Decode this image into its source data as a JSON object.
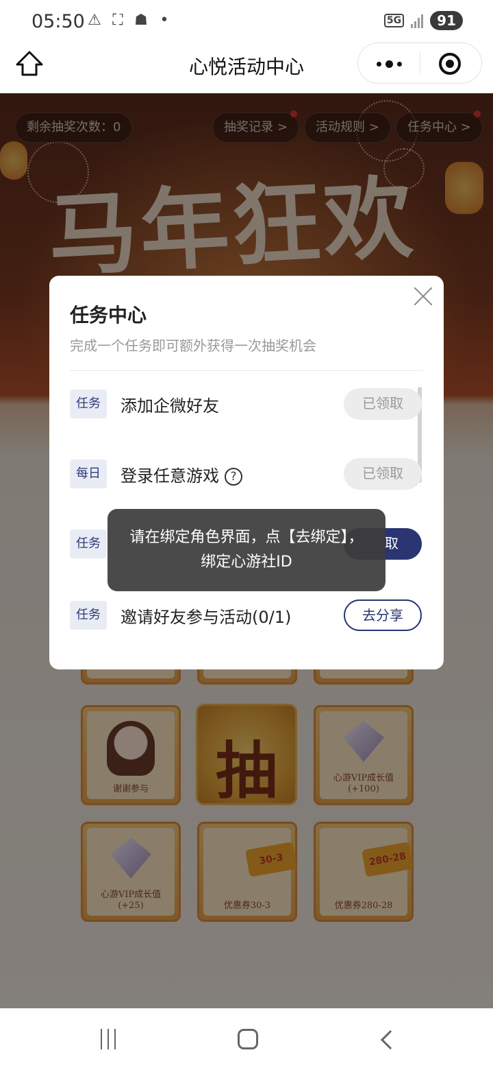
{
  "status_bar": {
    "time": "05:50",
    "network": "5G",
    "battery": "91"
  },
  "nav": {
    "title": "心悦活动中心"
  },
  "page": {
    "remaining_draws": "剩余抽奖次数：0",
    "banner_title": "马年狂欢",
    "links": {
      "records": "抽奖记录 >",
      "rules": "活动规则 >",
      "tasks": "任务中心 >"
    },
    "draw_button": "抽",
    "prizes": [
      {
        "label": "谢谢参与"
      },
      {
        "label": "心游VIP成长值\n(+100)"
      },
      {
        "label": "心游VIP成长值\n(+25)"
      },
      {
        "label": "优惠券30-3",
        "ticket": "30-3"
      },
      {
        "label": "优惠券280-28",
        "ticket": "280-28"
      }
    ]
  },
  "modal": {
    "title": "任务中心",
    "subtitle": "完成一个任务即可额外获得一次抽奖机会",
    "tasks": [
      {
        "tag": "任务",
        "name": "添加企微好友",
        "button": "已领取"
      },
      {
        "tag": "每日",
        "name": "登录任意游戏",
        "button": "已领取"
      },
      {
        "tag": "任务",
        "name": "",
        "button": "取"
      },
      {
        "tag": "任务",
        "name": "邀请好友参与活动(0/1)",
        "button": "去分享"
      }
    ]
  },
  "toast": {
    "message": "请在绑定角色界面，点【去绑定】，绑定心游社ID"
  },
  "colors": {
    "accent": "#2a3572",
    "tag_bg": "#e9ecf4",
    "done_bg": "#ececec"
  }
}
